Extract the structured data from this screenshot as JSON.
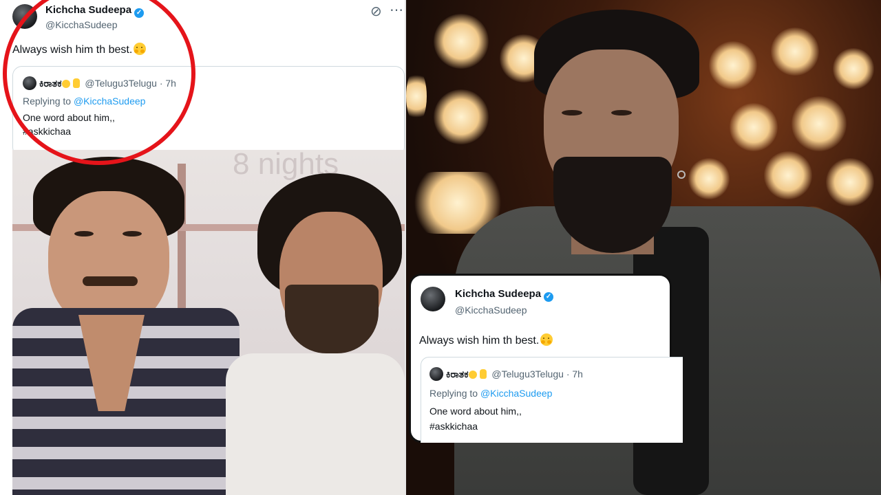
{
  "tweet": {
    "author_name": "Kichcha Sudeepa",
    "author_handle": "@KicchaSudeep",
    "text": "Always wish him th best.",
    "quoted": {
      "author_name": "ಕಿರಾತಕ",
      "author_handle": "@Telugu3Telugu",
      "separator": "·",
      "time": "7h",
      "reply_label": "Replying to",
      "reply_handle": "@KicchaSudeep",
      "text_line1": "One word about him,,",
      "text_line2": "#askkichaa"
    },
    "photo_sign_text": "8 nights"
  },
  "icons": {
    "grok": "slash-circle-icon",
    "more": "more-horizontal-icon",
    "verified": "verified-badge-icon",
    "hug": "hugging-face-emoji",
    "wink": "winking-face-emoji",
    "victory": "victory-hand-emoji"
  },
  "colors": {
    "annotation_circle": "#e5141a",
    "verified_blue": "#1d9bf0",
    "handle_gray": "#536471"
  }
}
